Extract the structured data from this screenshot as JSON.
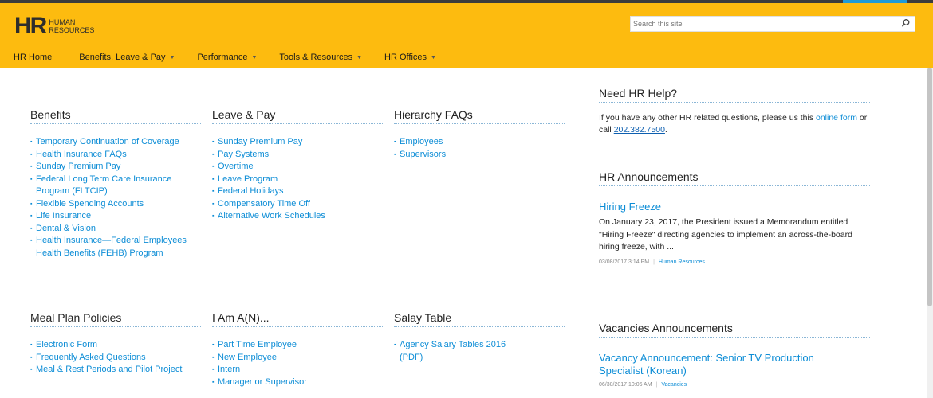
{
  "logo": {
    "mark": "HR",
    "line1": "HUMAN",
    "line2": "RESOURCES"
  },
  "search": {
    "placeholder": "Search this site"
  },
  "nav": [
    {
      "label": "HR Home",
      "dropdown": false
    },
    {
      "label": "Benefits, Leave & Pay",
      "dropdown": true
    },
    {
      "label": "Performance",
      "dropdown": true
    },
    {
      "label": "Tools & Resources",
      "dropdown": true
    },
    {
      "label": "HR Offices",
      "dropdown": true
    }
  ],
  "nav_caret": "▼",
  "sections": [
    {
      "title": "Benefits",
      "links": [
        "Temporary Continuation of Coverage",
        "Health Insurance FAQs",
        "Sunday Premium Pay",
        "Federal Long Term Care Insurance Program (FLTCIP)",
        "Flexible Spending Accounts",
        "Life Insurance",
        "Dental & Vision",
        "Health Insurance—Federal Employees Health Benefits (FEHB) Program"
      ]
    },
    {
      "title": "Leave & Pay",
      "links": [
        "Sunday Premium Pay",
        "Pay Systems",
        "Overtime",
        "Leave Program",
        "Federal Holidays",
        "Compensatory Time Off",
        "Alternative Work Schedules"
      ]
    },
    {
      "title": "Hierarchy FAQs",
      "links": [
        "Employees",
        "Supervisors"
      ]
    },
    {
      "title": "Meal Plan Policies",
      "links": [
        "Electronic Form",
        "Frequently Asked Questions",
        "Meal & Rest Periods and Pilot Project"
      ]
    },
    {
      "title": "I Am A(N)...",
      "links": [
        "Part Time Employee",
        "New Employee",
        "Intern",
        "Manager or Supervisor"
      ]
    },
    {
      "title": "Salay Table",
      "links": [
        "Agency Salary Tables 2016 (PDF)"
      ]
    }
  ],
  "help": {
    "title": "Need HR Help?",
    "text_before": "If you have any other HR related questions, please us this ",
    "link_text": "online form",
    "text_middle": " or call ",
    "phone": "202.382.7500",
    "text_after": "."
  },
  "announcements": {
    "title": "HR Announcements",
    "item_title": "Hiring Freeze",
    "body": "On January 23, 2017, the President issued a Memorandum entitled \"Hiring Freeze\" directing agencies to implement an across-the-board hiring freeze, with ...",
    "date": "03/08/2017 3:14 PM",
    "separator": "|",
    "category": "Human Resources"
  },
  "vacancies": {
    "title": "Vacancies Announcements",
    "item_title": "Vacancy Announcement: Senior TV Production Specialist (Korean)",
    "date": "06/30/2017 10:06 AM",
    "separator": "|",
    "category": "Vacancies"
  },
  "colors": {
    "header": "#fdbb0f",
    "link": "#0d8dd6",
    "topbar": "#3c3c3c",
    "accent": "#1e9bd7"
  }
}
